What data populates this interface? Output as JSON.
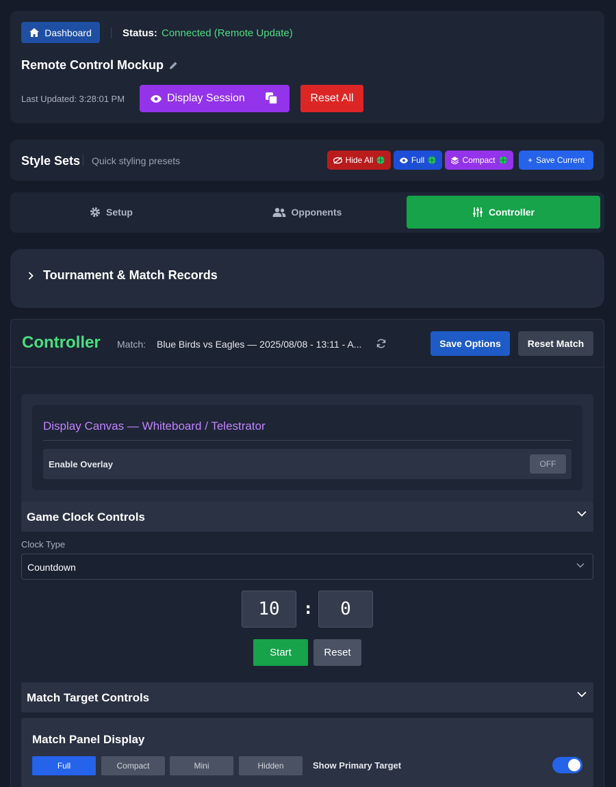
{
  "header": {
    "dashboard_label": "Dashboard",
    "status_label": "Status:",
    "status_value": "Connected (Remote Update)",
    "title": "Remote Control Mockup",
    "last_updated": "Last Updated: 3:28:01 PM",
    "display_session_label": "Display Session",
    "reset_all_label": "Reset All"
  },
  "style_sets": {
    "title": "Style Sets",
    "subtitle": "Quick styling presets",
    "chips": [
      {
        "label": "Hide All",
        "color": "#b91c1c"
      },
      {
        "label": "Full",
        "color": "#1d4ed8"
      },
      {
        "label": "Compact",
        "color": "#9333ea"
      },
      {
        "label": "Save Current",
        "color": "#2563eb"
      }
    ]
  },
  "tabs": [
    {
      "label": "Setup",
      "icon": "gear-icon",
      "active": false
    },
    {
      "label": "Opponents",
      "icon": "users-icon",
      "active": false
    },
    {
      "label": "Controller",
      "icon": "sliders-icon",
      "active": true
    }
  ],
  "tournament": {
    "title": "Tournament & Match Records"
  },
  "controller": {
    "title": "Controller",
    "match_label": "Match:",
    "match_value": "Blue Birds vs Eagles — 2025/08/08 - 13:11 - A...",
    "save_options_label": "Save Options",
    "reset_match_label": "Reset Match",
    "canvas": {
      "title": "Display Canvas — Whiteboard / Telestrator",
      "overlay_label": "Enable Overlay",
      "overlay_state": "OFF"
    },
    "game_clock": {
      "title": "Game Clock Controls",
      "clock_type_label": "Clock Type",
      "clock_type_value": "Countdown",
      "minutes": "10",
      "seconds": "0",
      "start_label": "Start",
      "reset_label": "Reset"
    },
    "match_target": {
      "title": "Match Target Controls",
      "panel_title": "Match Panel Display",
      "options": [
        "Full",
        "Compact",
        "Mini",
        "Hidden"
      ],
      "selected": "Full",
      "primary_label": "Show Primary Target",
      "primary_on": true
    }
  },
  "colors": {
    "accent_green": "#16a34a",
    "status_green": "#4ade80",
    "purple": "#9333ea",
    "red": "#dc2626",
    "blue": "#2563eb"
  }
}
